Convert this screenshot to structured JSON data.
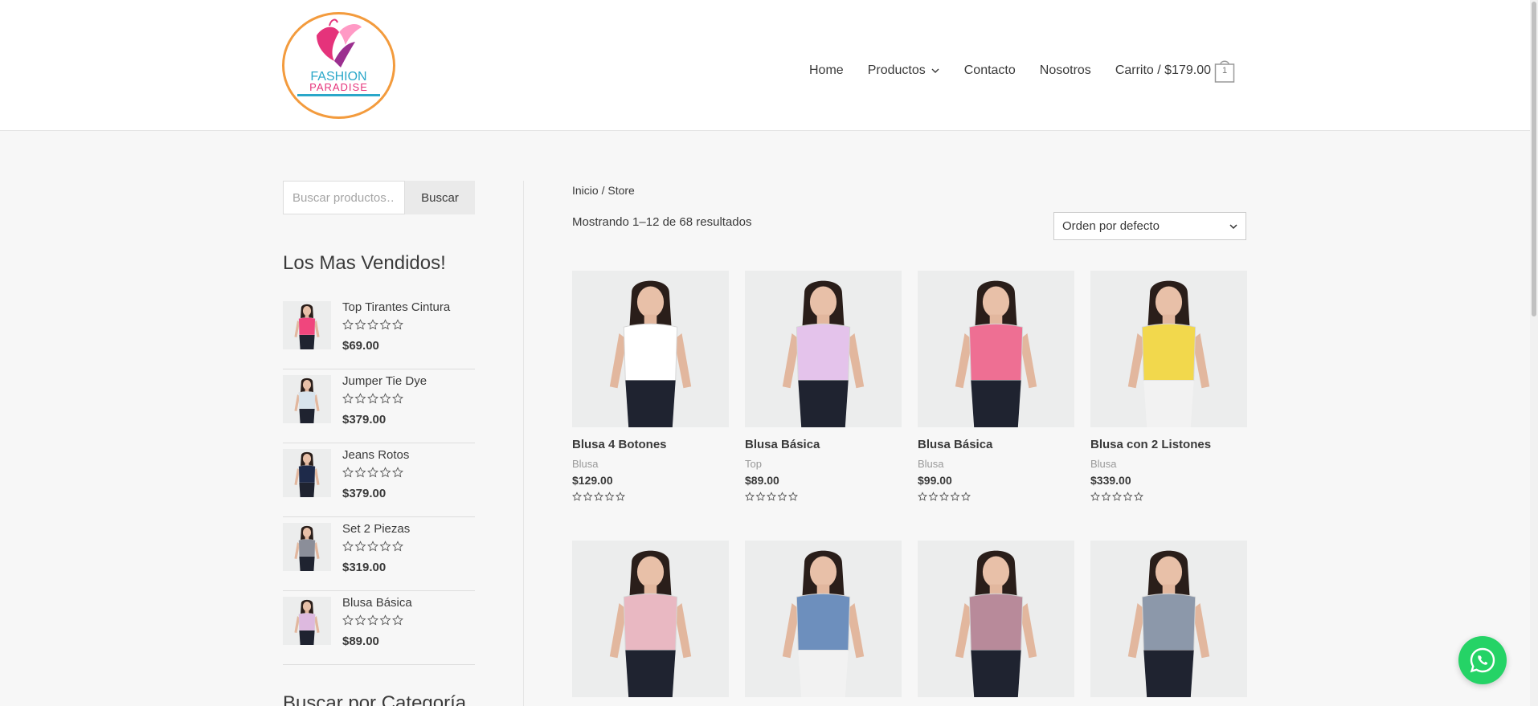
{
  "header": {
    "logo_text": "FASHION PARADISE",
    "nav": {
      "home": "Home",
      "products": "Productos",
      "contact": "Contacto",
      "about": "Nosotros",
      "cart": "Carrito / $179.00",
      "cart_count": "1"
    }
  },
  "sidebar": {
    "search_placeholder": "Buscar productos…",
    "search_button": "Buscar",
    "bestsellers_title": "Los Mas Vendidos!",
    "bestsellers": [
      {
        "name": "Top Tirantes Cintura",
        "price": "$69.00",
        "color": "#f0467d"
      },
      {
        "name": "Jumper Tie Dye",
        "price": "$379.00",
        "color": "#d8e3ec"
      },
      {
        "name": "Jeans Rotos",
        "price": "$379.00",
        "color": "#1e2a4a"
      },
      {
        "name": "Set 2 Piezas",
        "price": "$319.00",
        "color": "#8b8e99"
      },
      {
        "name": "Blusa Básica",
        "price": "$89.00",
        "color": "#ddb9df"
      }
    ],
    "categories_title": "Buscar por Categoría"
  },
  "main": {
    "breadcrumb": "Inicio / Store",
    "result_count": "Mostrando 1–12 de 68 resultados",
    "orderby": "Orden por defecto",
    "products": [
      {
        "title": "Blusa 4 Botones",
        "category": "Blusa",
        "price": "$129.00",
        "color": "#ffffff"
      },
      {
        "title": "Blusa Básica",
        "category": "Top",
        "price": "$89.00",
        "color": "#e4c3eb"
      },
      {
        "title": "Blusa Básica",
        "category": "Blusa",
        "price": "$99.00",
        "color": "#ee6f93"
      },
      {
        "title": "Blusa con 2 Listones",
        "category": "Blusa",
        "price": "$339.00",
        "color": "#f2d84c"
      },
      {
        "color": "#e9b8c2"
      },
      {
        "color": "#6d8fbd"
      },
      {
        "color": "#b88a9a"
      },
      {
        "color": "#8c98aa"
      }
    ]
  },
  "colors": {
    "accent_whatsapp": "#25d366",
    "logo_orange": "#f39b3d",
    "logo_pink": "#e5337b",
    "logo_cyan": "#2aa7c9"
  }
}
